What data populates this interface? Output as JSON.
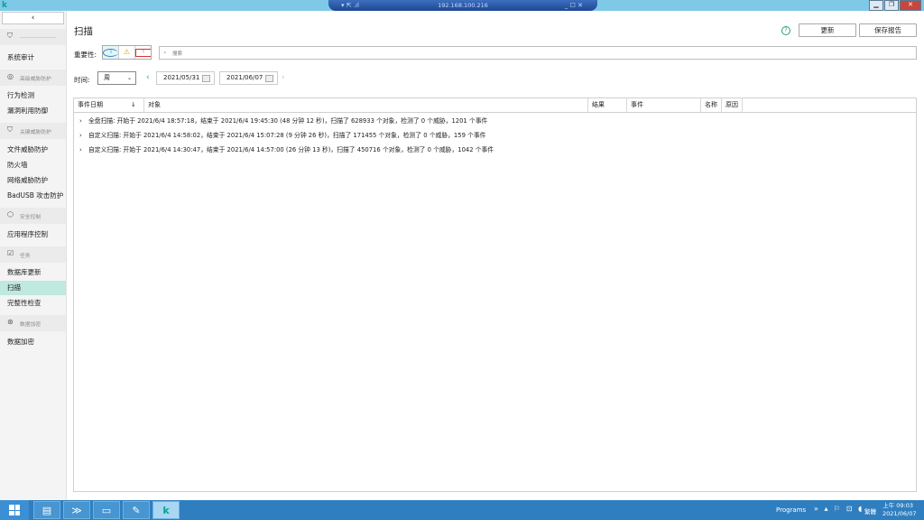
{
  "window": {
    "app_logo": "k",
    "rdp_left": "▾ ⇱ .ıl",
    "rdp_ip": "192.168.100.216",
    "rdp_right": "_ ☐ ✕",
    "controls": [
      "▁",
      "❐",
      "✕"
    ]
  },
  "sidebar": {
    "collapse": "‹",
    "groups": [
      {
        "icon": "shield-icon",
        "glyph": "⛉",
        "label": ""
      },
      {
        "icon": "advanced-protection-icon",
        "glyph": "◎",
        "label": "高级威胁防护"
      },
      {
        "icon": "shield-outline-icon",
        "glyph": "⛉",
        "label": "关键威胁防护"
      },
      {
        "icon": "security-control-icon",
        "glyph": "⬡",
        "label": "安全控制"
      },
      {
        "icon": "task-icon",
        "glyph": "☑",
        "label": "任务"
      },
      {
        "icon": "data-encryption-icon",
        "glyph": "⊛",
        "label": "数据加密"
      }
    ],
    "items": [
      "系统审计",
      "行为检测",
      "漏洞利用防御",
      "文件威胁防护",
      "防火墙",
      "网络威胁防护",
      "BadUSB 攻击防护",
      "应用程序控制",
      "数据库更新",
      "扫描",
      "完整性检查",
      "数据加密"
    ],
    "active_index": 9
  },
  "main": {
    "title": "扫描",
    "help": "?",
    "update_button": "更新",
    "save_report_button": "保存报告",
    "importance_label": "重要性:",
    "importance_icons": {
      "info": "i",
      "warning": "⚠",
      "critical": "!"
    },
    "search_placeholder": "搜索",
    "time_label": "时间:",
    "time_value": "周",
    "date_from": "2021/05/31",
    "date_to": "2021/06/07",
    "prev": "‹",
    "next": "›",
    "sort_icon": "↓"
  },
  "table": {
    "columns": [
      "事件日期",
      "对象",
      "结果",
      "事件",
      "名称",
      "原因"
    ],
    "rows": [
      "全盘扫描: 开始于 2021/6/4 18:57:18，结束于 2021/6/4 19:45:30 (48 分钟 12 秒)，扫描了 628933 个对象，检测了 0 个威胁，1201 个事件",
      "自定义扫描: 开始于 2021/6/4 14:58:02，结束于 2021/6/4 15:07:28 (9 分钟 26 秒)，扫描了 171455 个对象，检测了 0 个威胁，159 个事件",
      "自定义扫描: 开始于 2021/6/4 14:30:47，结束于 2021/6/4 14:57:00 (26 分钟 13 秒)，扫描了 450716 个对象，检测了 0 个威胁，1042 个事件"
    ]
  },
  "taskbar": {
    "apps": [
      {
        "name": "server-manager-icon",
        "glyph": "▤"
      },
      {
        "name": "powershell-icon",
        "glyph": "≫"
      },
      {
        "name": "file-explorer-icon",
        "glyph": "▭"
      },
      {
        "name": "tools-icon",
        "glyph": "✎"
      },
      {
        "name": "kaspersky-icon",
        "glyph": "k"
      }
    ],
    "programs_label": "Programs",
    "tray_icons": "» ▴ ⚐ ⊡ ◖",
    "ime": "繁體",
    "time": "上午 09:03",
    "date": "2021/06/07"
  }
}
